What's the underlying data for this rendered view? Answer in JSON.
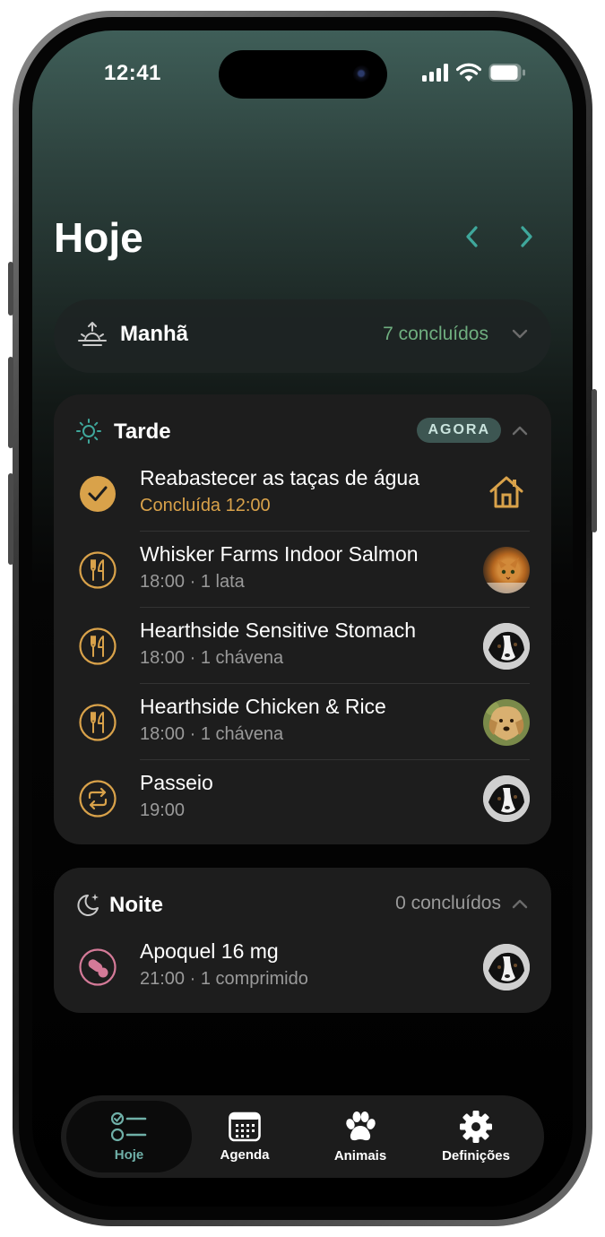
{
  "status_bar": {
    "time": "12:41"
  },
  "header": {
    "title": "Hoje"
  },
  "sections": {
    "morning": {
      "title": "Manhã",
      "count": "7 concluídos"
    },
    "afternoon": {
      "title": "Tarde",
      "badge": "AGORA",
      "items": [
        {
          "title": "Reabastecer as taças de água",
          "subtitle": "Concluída 12:00",
          "icon": "check-icon",
          "right": "home-icon"
        },
        {
          "title": "Whisker Farms Indoor Salmon",
          "subtitle": "18:00 · 1 lata",
          "icon": "fork-knife-icon",
          "right": "cat-avatar"
        },
        {
          "title": "Hearthside Sensitive Stomach",
          "subtitle": "18:00 · 1 chávena",
          "icon": "fork-knife-icon",
          "right": "border-collie-avatar"
        },
        {
          "title": "Hearthside Chicken & Rice",
          "subtitle": "18:00 · 1 chávena",
          "icon": "fork-knife-icon",
          "right": "golden-retriever-avatar"
        },
        {
          "title": "Passeio",
          "subtitle": "19:00",
          "icon": "repeat-icon",
          "right": "border-collie-avatar"
        }
      ]
    },
    "night": {
      "title": "Noite",
      "count": "0 concluídos",
      "items": [
        {
          "title": "Apoquel 16 mg",
          "subtitle": "21:00 · 1 comprimido",
          "icon": "pill-icon",
          "right": "border-collie-avatar"
        }
      ]
    }
  },
  "tabbar": {
    "tabs": [
      {
        "label": "Hoje",
        "icon": "checklist-icon",
        "active": true
      },
      {
        "label": "Agenda",
        "icon": "calendar-icon",
        "active": false
      },
      {
        "label": "Animais",
        "icon": "paw-icon",
        "active": false
      },
      {
        "label": "Definições",
        "icon": "gear-icon",
        "active": false
      }
    ]
  },
  "colors": {
    "accent_teal": "#3fa79b",
    "done_gold": "#d9a24a",
    "morning_green": "#6fae7f",
    "pill_pink": "#d47a98"
  }
}
